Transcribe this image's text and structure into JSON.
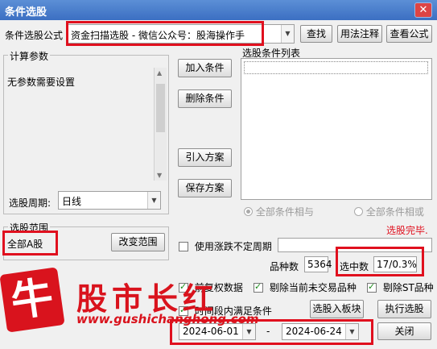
{
  "window": {
    "title": "条件选股"
  },
  "formula": {
    "label": "条件选股公式",
    "selected": "资金扫描选股  -  微信公众号：股海操作手",
    "find_button": "查找",
    "usage_button": "用法注释",
    "view_button": "查看公式"
  },
  "params": {
    "group_label": "计算参数",
    "text": "无参数需要设置",
    "period_label": "选股周期:",
    "period_value": "日线"
  },
  "actions": {
    "add_condition": "加入条件",
    "delete_condition": "删除条件",
    "import_scheme": "引入方案",
    "save_scheme": "保存方案"
  },
  "condition_list": {
    "label": "选股条件列表",
    "radio_and": "全部条件相与",
    "radio_or": "全部条件相或"
  },
  "scope": {
    "group_label": "选股范围",
    "value": "全部A股",
    "change_button": "改变范围"
  },
  "status": {
    "done": "选股完毕.",
    "variety_label": "品种数",
    "variety_count": "5364",
    "hit_label": "选中数",
    "hit_value": "17/0.3%"
  },
  "options": {
    "use_variable_period": "使用涨跌不定周期",
    "pre_data": "前复权数据",
    "exclude_untraded": "剔除当前未交易品种",
    "exclude_st": "剔除ST品种",
    "time_range": "时间段内满足条件"
  },
  "date_range": {
    "start": "2024-06-01",
    "separator": "-",
    "end": "2024-06-24"
  },
  "footer_buttons": {
    "to_block": "选股入板块",
    "execute": "执行选股",
    "close": "关闭"
  },
  "watermark": {
    "logo_char": "牛",
    "brand": "股市长红",
    "url": "www.gushichanghong.com"
  },
  "colors": {
    "highlight": "#e0101e",
    "status_red": "#e0101e",
    "watermark_red": "#d9131d"
  }
}
